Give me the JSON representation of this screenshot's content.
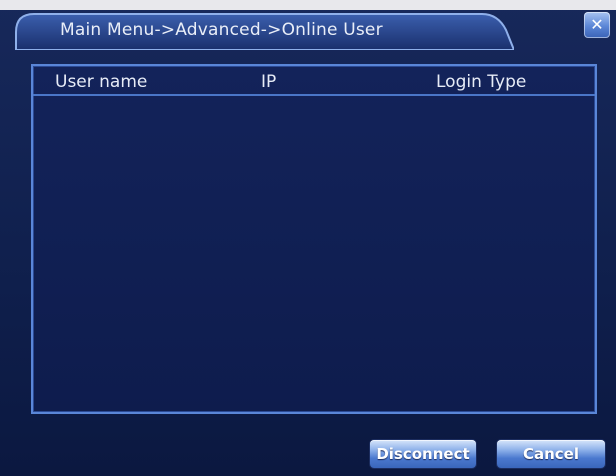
{
  "window": {
    "title": "Main Menu->Advanced->Online User",
    "close_icon": "close-icon"
  },
  "list": {
    "columns": [
      "User name",
      "IP",
      "Login Type"
    ],
    "rows": []
  },
  "buttons": {
    "disconnect": "Disconnect",
    "cancel": "Cancel"
  },
  "colors": {
    "background": "#0f1f4c",
    "accent_border": "#5a86d8",
    "button": "#4b79cf",
    "text": "#e9eef8"
  }
}
